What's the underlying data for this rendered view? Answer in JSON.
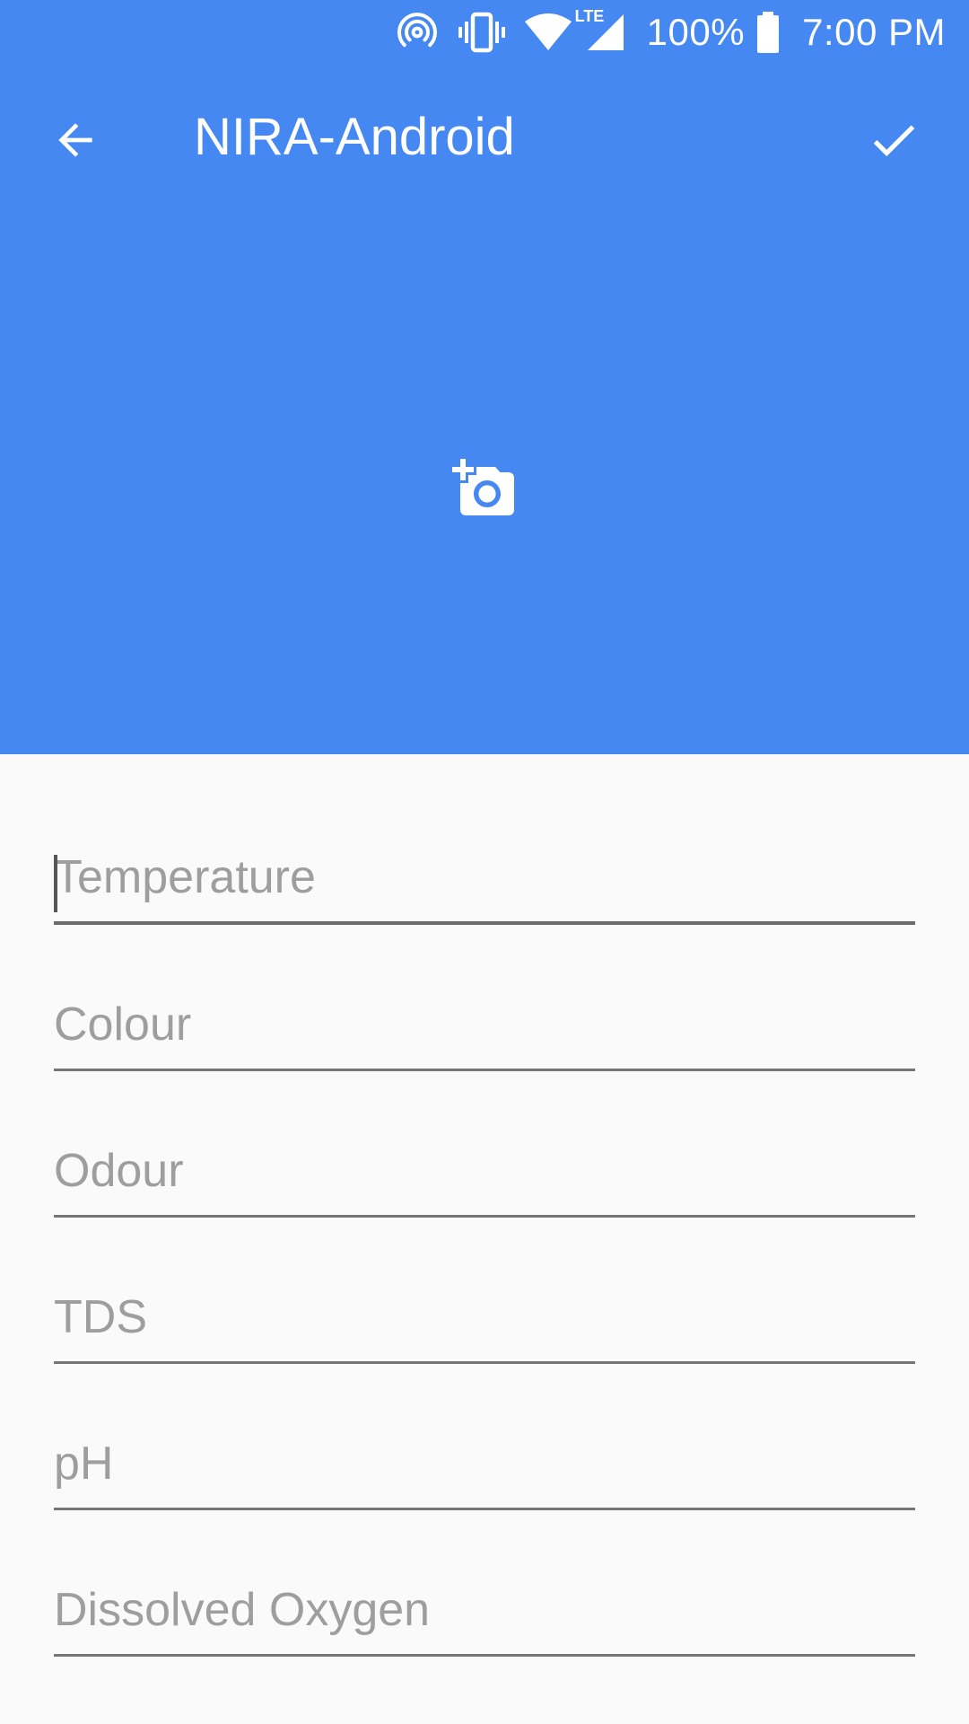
{
  "status_bar": {
    "icons": [
      "hotspot-icon",
      "vibrate-icon",
      "wifi-icon",
      "lte-signal-icon",
      "battery-icon"
    ],
    "lte_label": "LTE",
    "battery_percent": "100%",
    "time": "7:00 PM"
  },
  "toolbar": {
    "title": "NIRA-Android",
    "back_icon": "arrow-back-icon",
    "confirm_icon": "check-icon"
  },
  "header": {
    "background_color": "#4688f1",
    "photo_icon": "add-a-photo-icon"
  },
  "form": {
    "fields": [
      {
        "placeholder": "Temperature",
        "value": "",
        "focused": true
      },
      {
        "placeholder": "Colour",
        "value": ""
      },
      {
        "placeholder": "Odour",
        "value": ""
      },
      {
        "placeholder": "TDS",
        "value": ""
      },
      {
        "placeholder": "pH",
        "value": ""
      },
      {
        "placeholder": "Dissolved Oxygen",
        "value": ""
      }
    ]
  }
}
